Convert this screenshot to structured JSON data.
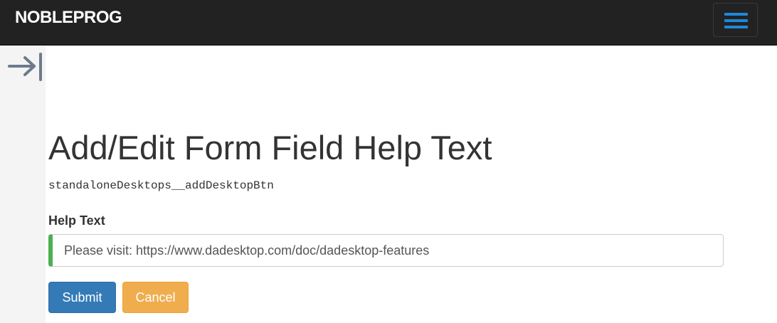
{
  "header": {
    "brand": "NOBLEPROG",
    "menu_icon": "hamburger-menu-icon",
    "accent_color": "#1e88d8",
    "background_color": "#222222"
  },
  "sidebar": {
    "toggle_icon": "arrow-right-to-bar-icon",
    "icon_color": "#6c7b8b"
  },
  "main": {
    "title": "Add/Edit Form Field Help Text",
    "field_key": "standaloneDesktops__addDesktopBtn",
    "help_label": "Help Text",
    "help_value": "Please visit: https://www.dadesktop.com/doc/dadesktop-features",
    "input_accent_color": "#4caf50"
  },
  "actions": {
    "submit_label": "Submit",
    "submit_color": "#337ab7",
    "cancel_label": "Cancel",
    "cancel_color": "#f0ad4e"
  }
}
